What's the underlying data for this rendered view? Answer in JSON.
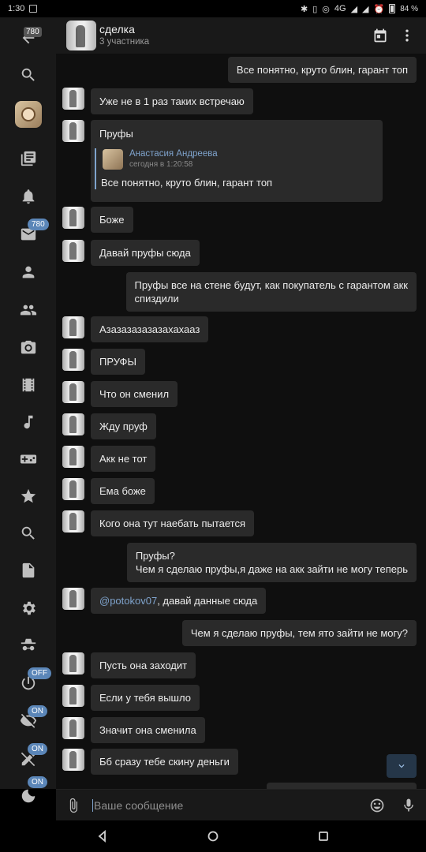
{
  "status_bar": {
    "time": "1:30",
    "battery": "84 %",
    "network": "4G"
  },
  "sidebar": {
    "back_badge": "780",
    "mail_badge": "780",
    "toggles": [
      "OFF",
      "ON",
      "ON",
      "ON"
    ]
  },
  "header": {
    "title": "сделка",
    "subtitle": "3 участника"
  },
  "messages": [
    {
      "dir": "out",
      "text": "Все понятно, круто блин, гарант топ"
    },
    {
      "dir": "in",
      "text": "Уже не в 1 раз таких встречаю"
    },
    {
      "dir": "in",
      "text": "Пруфы",
      "quote": {
        "author": "Анастасия Андреева",
        "time": "сегодня в 1:20:58",
        "text": "Все понятно, круто блин, гарант топ"
      }
    },
    {
      "dir": "in",
      "text": "Боже"
    },
    {
      "dir": "in",
      "text": "Давай пруфы сюда"
    },
    {
      "dir": "out",
      "text": "Пруфы все на стене будут, как покупатель с гарантом акк",
      "text2": "спиздили"
    },
    {
      "dir": "in",
      "text": "Азазазазазазахахааз"
    },
    {
      "dir": "in",
      "text": "ПРУФЫ"
    },
    {
      "dir": "in",
      "text": "Что он сменил"
    },
    {
      "dir": "in",
      "text": "Жду пруф"
    },
    {
      "dir": "in",
      "text": "Акк не тот"
    },
    {
      "dir": "in",
      "text": "Ема боже"
    },
    {
      "dir": "in",
      "text": "Кого она тут наебать пытается"
    },
    {
      "dir": "out",
      "text": "Пруфы?",
      "text2": "Чем я сделаю пруфы,я даже на акк зайти не могу теперь"
    },
    {
      "dir": "in",
      "mention": "@potokov07",
      "text": ", давай данные сюда"
    },
    {
      "dir": "out",
      "text": "Чем я сделаю пруфы, тем ято зайти не могу?"
    },
    {
      "dir": "in",
      "text": "Пусть она заходит"
    },
    {
      "dir": "in",
      "text": "Если у тебя вышло"
    },
    {
      "dir": "in",
      "text": "Значит она сменила"
    },
    {
      "dir": "in",
      "text": "Бб сразу тебе скину деньги"
    }
  ],
  "composer": {
    "placeholder": "Ваше сообщение"
  }
}
